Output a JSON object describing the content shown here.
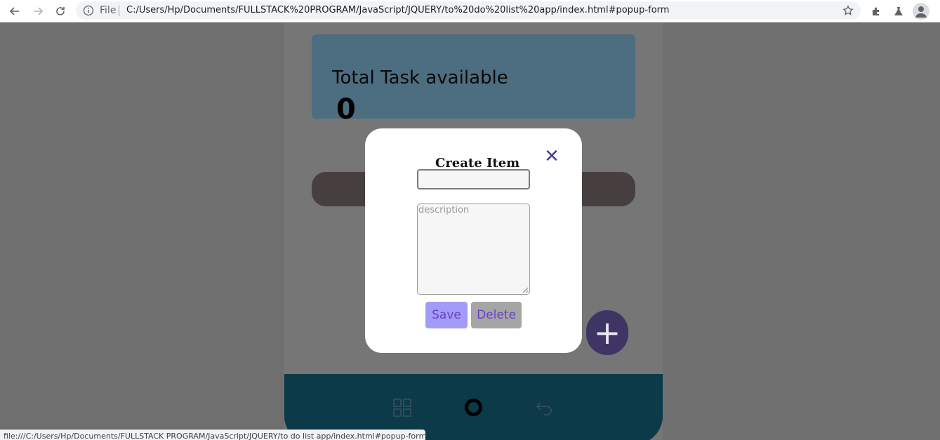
{
  "browser": {
    "omnibox_scheme": "File",
    "url": "C:/Users/Hp/Documents/FULLSTACK%20PROGRAM/JavaScript/JQUERY/to%20do%20list%20app/index.html#popup-form",
    "status_url": "file:///C:/Users/Hp/Documents/FULLSTACK PROGRAM/JavaScript/JQUERY/to do list app/index.html#popup-form"
  },
  "app": {
    "total_title": "Total Task available",
    "total_count": "0",
    "fab_symbol": "+",
    "bottom_nav": [
      "grid-icon",
      "circle-icon",
      "undo-icon"
    ]
  },
  "modal": {
    "title": "Create Item",
    "close_symbol": "✕",
    "title_value": "",
    "description_placeholder": "description",
    "save_label": "Save",
    "delete_label": "Delete"
  },
  "colors": {
    "overlay": "#6f6f6f",
    "card": "#4d6d80",
    "bottom_nav": "#0c3a48",
    "fab": "#3f3565",
    "accent": "#4b3d8f",
    "save_bg": "#a39cf6"
  }
}
